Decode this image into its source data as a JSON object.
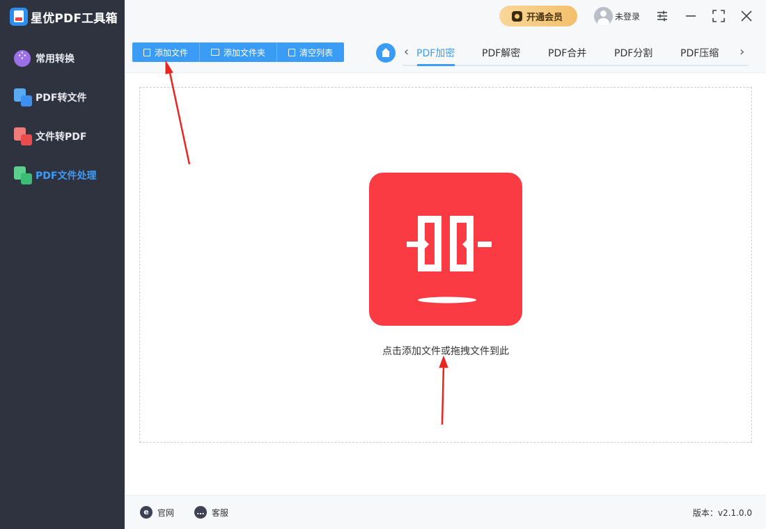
{
  "app": {
    "title": "星优PDF工具箱"
  },
  "sidebar": {
    "items": [
      {
        "label": "常用转换"
      },
      {
        "label": "PDF转文件"
      },
      {
        "label": "文件转PDF"
      },
      {
        "label": "PDF文件处理"
      }
    ]
  },
  "header": {
    "vip_label": "开通会员",
    "login_label": "未登录"
  },
  "toolbar": {
    "add_file": "添加文件",
    "add_folder": "添加文件夹",
    "clear_list": "清空列表"
  },
  "tabs": [
    {
      "label": "PDF加密"
    },
    {
      "label": "PDF解密"
    },
    {
      "label": "PDF合并"
    },
    {
      "label": "PDF分割"
    },
    {
      "label": "PDF压缩"
    }
  ],
  "dropzone": {
    "hint": "点击添加文件或拖拽文件到此"
  },
  "footer": {
    "website": "官网",
    "support": "客服",
    "version": "版本：v2.1.0.0"
  },
  "colors": {
    "accent": "#3b9cf5",
    "sidebar_bg": "#2f3340",
    "feature_icon": "#fb3b43",
    "annotation_arrow": "#e8261f"
  }
}
